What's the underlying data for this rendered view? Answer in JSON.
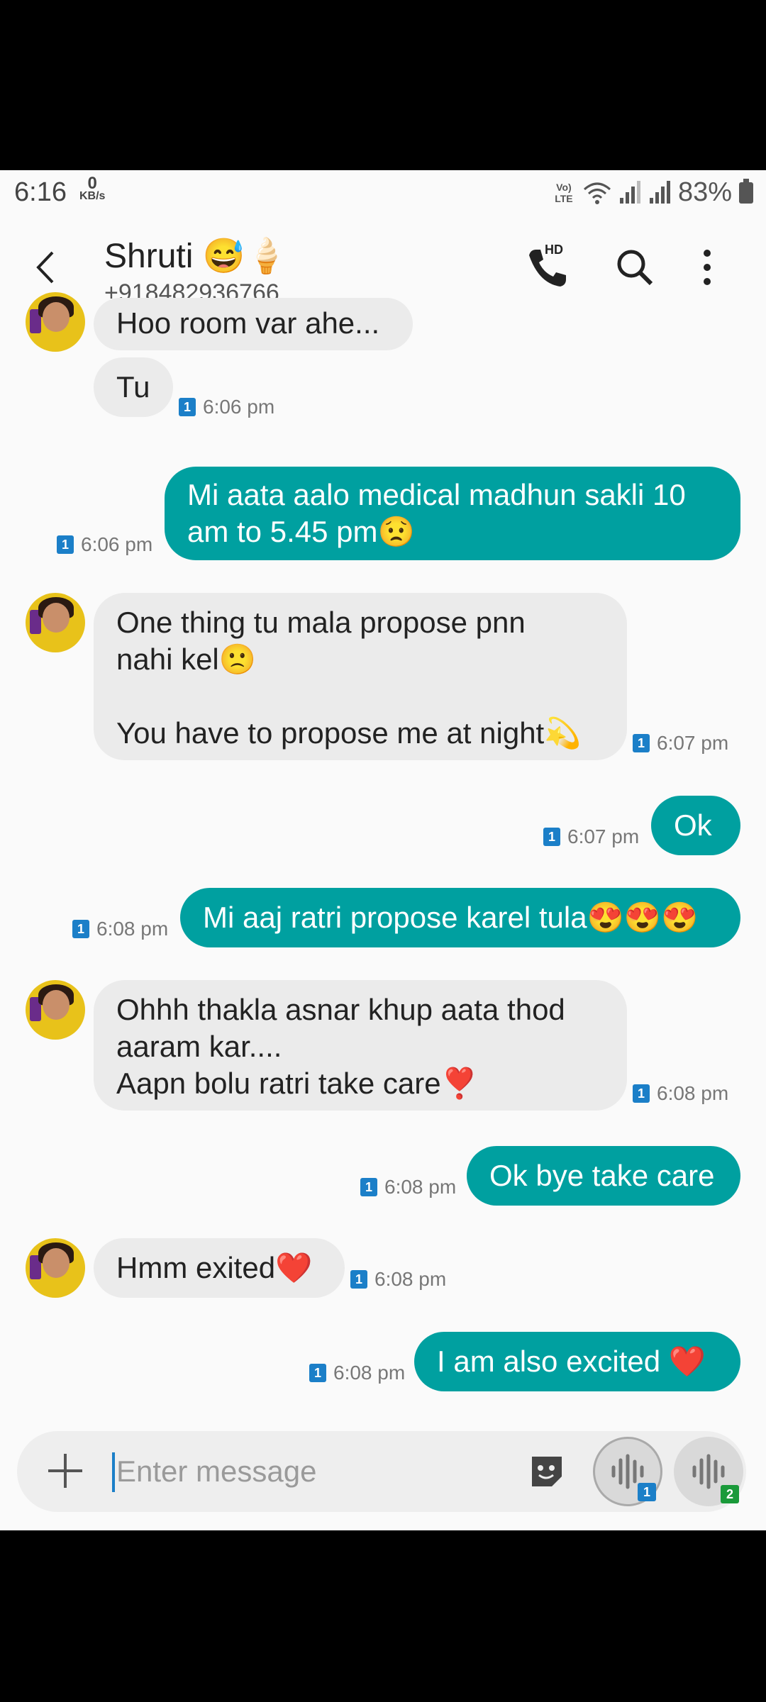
{
  "status_bar": {
    "time": "6:16",
    "net_speed_value": "0",
    "net_speed_unit": "KB/s",
    "volte": "Vo) LTE",
    "battery": "83%"
  },
  "header": {
    "contact_name": "Shruti 😅🍦",
    "contact_number": "+918482936766",
    "call_label": "HD"
  },
  "messages": [
    {
      "dir": "in",
      "text": "Hoo room var ahe...",
      "time": ""
    },
    {
      "dir": "in",
      "text": "Tu",
      "time": "6:06 pm"
    },
    {
      "dir": "out",
      "text": "Mi aata aalo medical madhun sakli 10\nam to 5.45 pm😟",
      "time": "6:06 pm"
    },
    {
      "dir": "in",
      "text": "One thing tu mala propose pnn\nnahi kel🙁\n\nYou have to propose me at night💫",
      "time": "6:07 pm"
    },
    {
      "dir": "out",
      "text": "Ok",
      "time": "6:07 pm"
    },
    {
      "dir": "out",
      "text": "Mi aaj ratri propose karel tula😍😍😍",
      "time": "6:08 pm"
    },
    {
      "dir": "in",
      "text": "Ohhh thakla asnar khup aata thod\naaram kar....\nAapn bolu ratri take care❣️",
      "time": "6:08 pm"
    },
    {
      "dir": "out",
      "text": "Ok bye take care",
      "time": "6:08 pm"
    },
    {
      "dir": "in",
      "text": "Hmm exited❤️",
      "time": "6:08 pm"
    },
    {
      "dir": "out",
      "text": "I am also excited ❤️",
      "time": "6:08 pm"
    }
  ],
  "sim_label": "1",
  "composer": {
    "placeholder": "Enter message",
    "voice1_badge": "1",
    "voice2_badge": "2"
  },
  "colors": {
    "outgoing": "#00a0a0",
    "incoming": "#ebebeb",
    "sim1": "#1b7fc8",
    "sim2": "#1a9a3a"
  }
}
